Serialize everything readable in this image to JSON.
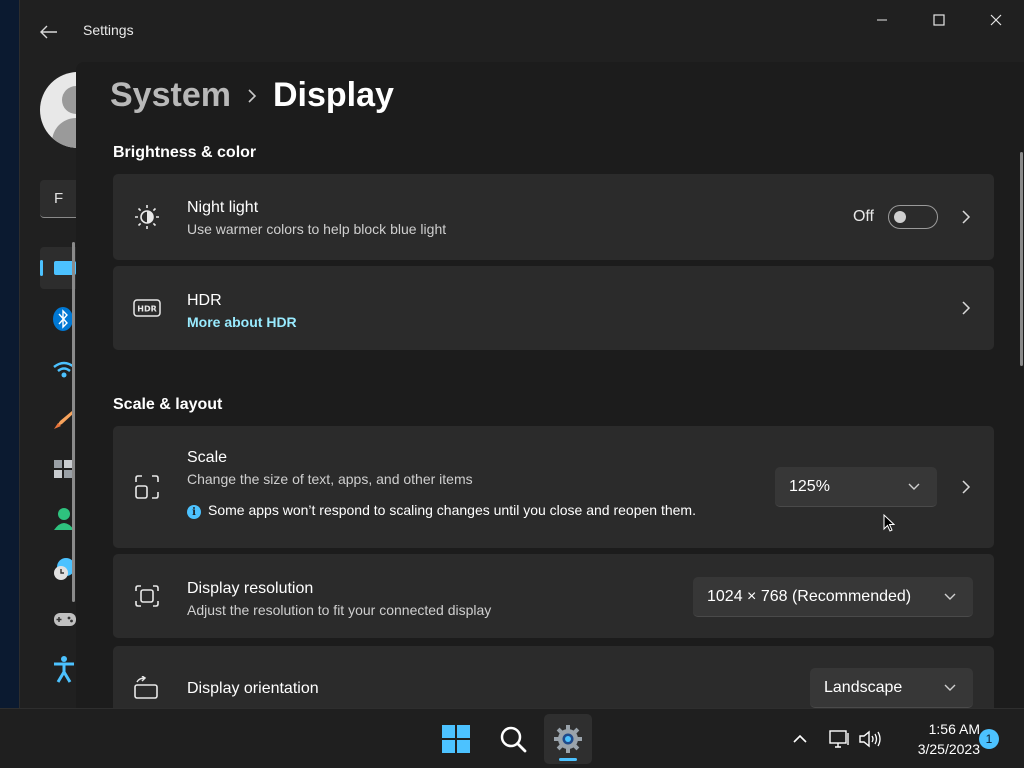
{
  "window": {
    "title": "Settings"
  },
  "nav": {
    "search_text": "F",
    "items": [
      {
        "name": "display-icon",
        "color": "#4cc2ff",
        "selected": true
      },
      {
        "name": "bluetooth-icon",
        "color": "#0078d4"
      },
      {
        "name": "wifi-icon",
        "color": "#4cc2ff"
      },
      {
        "name": "personalization-brush-icon",
        "color": "#f7a35c"
      },
      {
        "name": "apps-icon",
        "color": "#9aa0a6"
      },
      {
        "name": "accounts-icon",
        "color": "#2ec27e"
      },
      {
        "name": "time-language-icon",
        "color": "#4cc2ff"
      },
      {
        "name": "gaming-icon",
        "color": "#c0c0c0"
      },
      {
        "name": "accessibility-icon",
        "color": "#4cc2ff"
      }
    ]
  },
  "breadcrumb": {
    "parent": "System",
    "current": "Display"
  },
  "sections": {
    "brightness": {
      "title": "Brightness & color"
    },
    "scale_layout": {
      "title": "Scale & layout"
    }
  },
  "night_light": {
    "title": "Night light",
    "desc": "Use warmer colors to help block blue light",
    "state": "Off"
  },
  "hdr": {
    "title": "HDR",
    "link": "More about HDR"
  },
  "scale": {
    "title": "Scale",
    "desc": "Change the size of text, apps, and other items",
    "info": "Some apps won’t respond to scaling changes until you close and reopen them.",
    "value": "125%"
  },
  "resolution": {
    "title": "Display resolution",
    "desc": "Adjust the resolution to fit your connected display",
    "value": "1024 × 768 (Recommended)"
  },
  "orientation": {
    "title": "Display orientation",
    "value": "Landscape"
  },
  "taskbar": {
    "time": "1:56 AM",
    "date": "3/25/2023",
    "notifications": "1"
  },
  "colors": {
    "accent": "#4cc2ff",
    "link": "#99ebff",
    "card": "#2b2b2b",
    "background": "#1c1c1c"
  }
}
